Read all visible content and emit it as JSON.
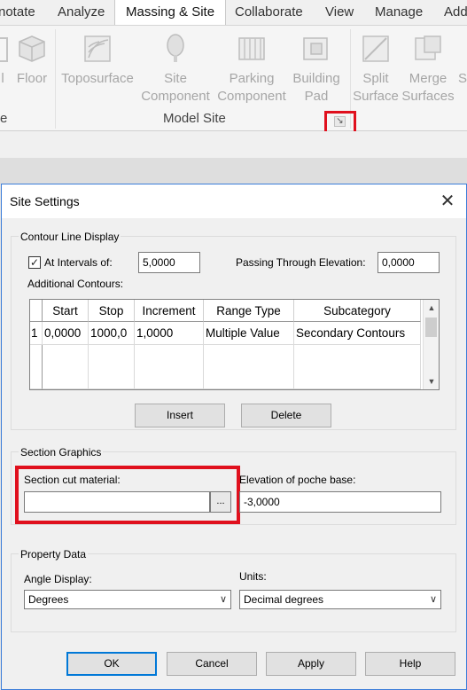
{
  "ribbon": {
    "tabs": [
      {
        "label": "notate"
      },
      {
        "label": "Analyze"
      },
      {
        "label": "Massing & Site"
      },
      {
        "label": "Collaborate"
      },
      {
        "label": "View"
      },
      {
        "label": "Manage"
      },
      {
        "label": "Add"
      }
    ],
    "buttons": [
      {
        "label_line1": "l",
        "label_line2": ""
      },
      {
        "label_line1": "Floor",
        "label_line2": ""
      },
      {
        "label_line1": "Toposurface",
        "label_line2": ""
      },
      {
        "label_line1": "Site",
        "label_line2": "Component"
      },
      {
        "label_line1": "Parking",
        "label_line2": "Component"
      },
      {
        "label_line1": "Building",
        "label_line2": "Pad"
      },
      {
        "label_line1": "Split",
        "label_line2": "Surface"
      },
      {
        "label_line1": "Merge",
        "label_line2": "Surfaces"
      },
      {
        "label_line1": "S",
        "label_line2": ""
      }
    ],
    "panel_left_label": "e",
    "panel_label": "Model Site",
    "launcher_glyph": "↘",
    "highlight_color": "#e0101d"
  },
  "dialog": {
    "title": "Site Settings",
    "close_glyph": "✕",
    "contour": {
      "group_title": "Contour Line Display",
      "check_glyph": "✓",
      "at_intervals_label": "At Intervals of:",
      "at_intervals_value": "5,0000",
      "passing_label": "Passing Through Elevation:",
      "passing_value": "0,0000",
      "additional_label": "Additional Contours:",
      "columns": [
        "Start",
        "Stop",
        "Increment",
        "Range Type",
        "Subcategory"
      ],
      "rows": [
        {
          "num": "1",
          "start": "0,0000",
          "stop": "1000,0",
          "increment": "1,0000",
          "range_type": "Multiple Value",
          "subcategory": "Secondary Contours"
        }
      ],
      "insert_label": "Insert",
      "delete_label": "Delete"
    },
    "section": {
      "group_title": "Section Graphics",
      "cut_material_label": "Section cut material:",
      "cut_material_value": "",
      "browse_label": "...",
      "poche_label": "Elevation of poche base:",
      "poche_value": "-3,0000"
    },
    "property": {
      "group_title": "Property Data",
      "angle_label": "Angle Display:",
      "angle_value": "Degrees",
      "units_label": "Units:",
      "units_value": "Decimal degrees"
    },
    "buttons": {
      "ok": "OK",
      "cancel": "Cancel",
      "apply": "Apply",
      "help": "Help"
    },
    "accent_color": "#0078d7"
  }
}
